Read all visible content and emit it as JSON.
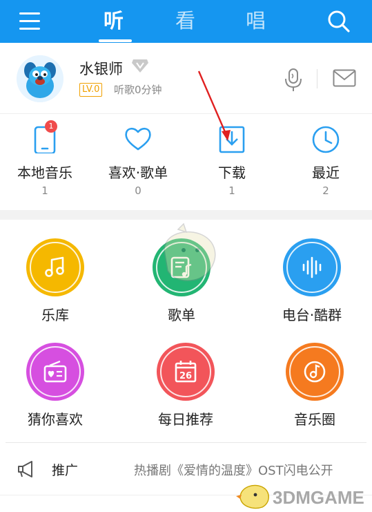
{
  "topbar": {
    "tabs": [
      {
        "label": "听",
        "active": true
      },
      {
        "label": "看",
        "active": false
      },
      {
        "label": "唱",
        "active": false
      }
    ],
    "color": "#1596f0"
  },
  "profile": {
    "username": "水银师",
    "level": "LV.0",
    "listen_time": "听歌0分钟"
  },
  "quick_actions": [
    {
      "label": "本地音乐",
      "count": "1",
      "badge": "1",
      "icon": "phone-icon"
    },
    {
      "label": "喜欢·歌单",
      "count": "0",
      "icon": "heart-icon"
    },
    {
      "label": "下载",
      "count": "1",
      "icon": "download-icon"
    },
    {
      "label": "最近",
      "count": "2",
      "icon": "clock-icon"
    }
  ],
  "features": [
    {
      "label": "乐库",
      "color": "#f5b800",
      "icon": "music-note-icon"
    },
    {
      "label": "歌单",
      "color": "#22b573",
      "icon": "playlist-icon"
    },
    {
      "label": "电台·酷群",
      "color": "#2a9ff0",
      "icon": "soundwave-icon"
    },
    {
      "label": "猜你喜欢",
      "color": "#d64fe0",
      "icon": "radio-heart-icon"
    },
    {
      "label": "每日推荐",
      "color": "#f2555a",
      "icon": "calendar-icon",
      "calendar_day": "26"
    },
    {
      "label": "音乐圈",
      "color": "#f57a1f",
      "icon": "disc-icon"
    }
  ],
  "promo": {
    "label": "推广",
    "text": "热播剧《爱情的温度》OST闪电公开",
    "icon": "megaphone-icon"
  },
  "watermark": {
    "text": "3DMGAME"
  }
}
